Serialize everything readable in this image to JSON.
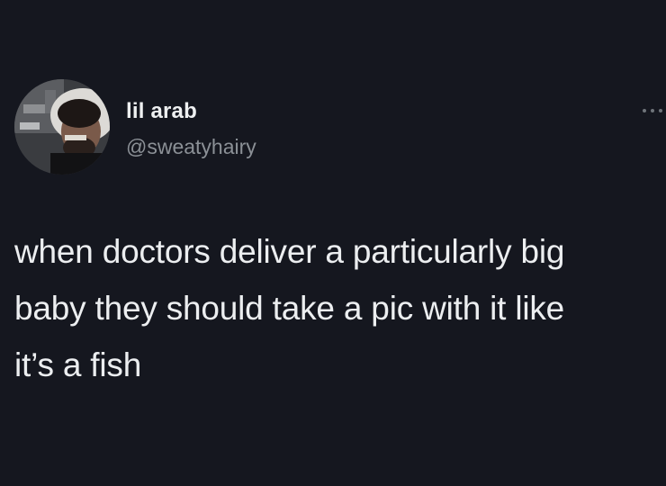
{
  "tweet": {
    "author": {
      "display_name": "lil arab",
      "handle": "@sweatyhairy"
    },
    "text_lines": [
      "when doctors deliver a particularly big",
      "baby they should take a pic with it like",
      "it’s a fish"
    ],
    "icons": {
      "avatar": "profile-photo",
      "more": "ellipsis-icon"
    }
  }
}
